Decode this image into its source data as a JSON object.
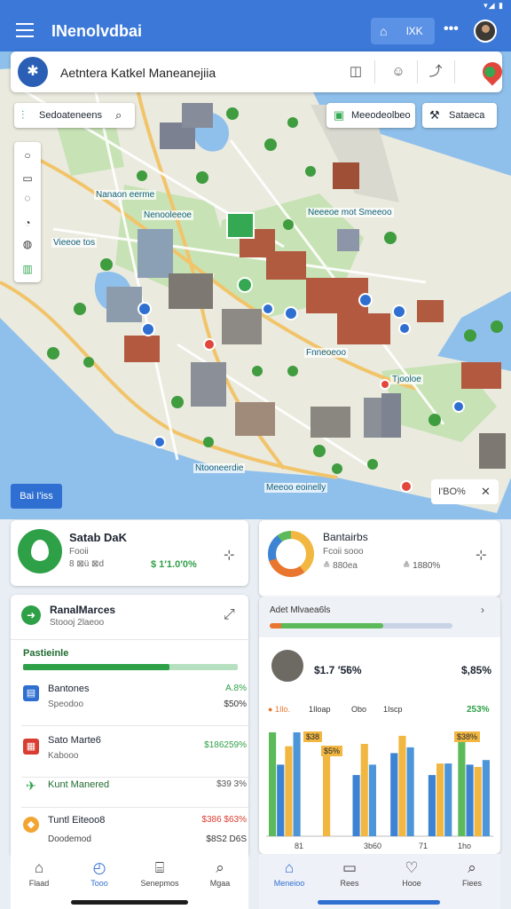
{
  "status_bar": {
    "icons": "▾◢ ▮"
  },
  "app_bar": {
    "title": "INenolvdbai",
    "home_chip_label": "lXK",
    "more": "•••"
  },
  "search": {
    "title": "Aetntera Katkel Maneanejiia"
  },
  "map": {
    "chip_left": "Sedoateneens",
    "chip_right_1": "Meeodeolbeo",
    "chip_right_2": "Sataeca",
    "labels": [
      "Nanaon eerme",
      "Nenooleeoe",
      "Neeeoe mot Smeeoo",
      "Vieeoe tos",
      "Fnneoeoo",
      "Tjooloe",
      "Ntooneerdie",
      "Meeoo eoinelly"
    ],
    "bottom_button": "Bai I'iss",
    "zoom_value": "I'BO%"
  },
  "card_a": {
    "title": "Satab DaK",
    "line1": "Fooii",
    "line2": "8 ⊠ü ⊠d",
    "value": "$ 1′1.0′0%"
  },
  "card_b": {
    "title": "Bantairbs",
    "line1": "Fcoii sooo",
    "line2": "≗ 880ea",
    "value": "≗ 1880%"
  },
  "list_card": {
    "header_title": "RanalMarces",
    "header_sub": "Stoooj 2laeoo",
    "section_label": "Pastieinle",
    "progress": 0.68,
    "rows": [
      {
        "title": "Bantones",
        "sub": "Speodoo",
        "value": "A.8%",
        "amount": "$50%",
        "icon": "building-icon"
      },
      {
        "title": "Sato Marte6",
        "sub": "Kabooo",
        "value": "$186259%",
        "amount": "",
        "icon": "calendar-icon"
      },
      {
        "title": "Kunt Manered",
        "sub": "",
        "value": "",
        "amount": "$39 3%",
        "icon": "plane-icon"
      },
      {
        "title": "Tuntl Eiteoo8",
        "sub": "Doodemod",
        "value": "$386 $63%",
        "amount": "$8S2 D6S",
        "icon": "tag-icon"
      }
    ]
  },
  "right_panel": {
    "filter_label": "Adet Mlvaea6ls",
    "progress": 0.62,
    "price": "$1.7 ′5̈6%",
    "price_right": "$,85%",
    "stats": [
      "1Ilo.",
      "1Iloap",
      "Obo",
      "1Iscp"
    ],
    "stat_right": "253%",
    "bar_labels": [
      "81",
      "3b60",
      "71",
      "1ho"
    ],
    "bar_chip_1": "$38",
    "bar_chip_2": "$5%",
    "bar_chip_3": "$38%"
  },
  "chart_data": {
    "type": "bar",
    "categories": [
      "81",
      "",
      "3b60",
      "",
      "71",
      "1ho"
    ],
    "series": [
      {
        "values": [
          0.9,
          0,
          0,
          0,
          0,
          0.9
        ]
      },
      {
        "values": [
          0.62,
          0,
          0.53,
          0.72,
          0.53,
          0.62
        ]
      },
      {
        "values": [
          0.78,
          0.72,
          0.8,
          0.87,
          0.63,
          0.6
        ]
      },
      {
        "values": [
          0.9,
          0,
          0.62,
          0.77,
          0.63,
          0.66
        ]
      }
    ],
    "colors": [
      "#5cba5a",
      "#3d83d3",
      "#f2b741",
      "#4b95d8"
    ],
    "ylim": [
      0,
      1
    ]
  },
  "nav_left": [
    "Flaad",
    "Tooo",
    "Senepmos",
    "Mgaa"
  ],
  "nav_right": [
    "Meneioo",
    "Rees",
    "Hooe",
    "Fiees"
  ],
  "colors": {
    "primary": "#3b78d8",
    "accent_green": "#34a853",
    "water": "#8fc0ec",
    "land": "#eaeadf",
    "park": "#c7e2b4"
  }
}
